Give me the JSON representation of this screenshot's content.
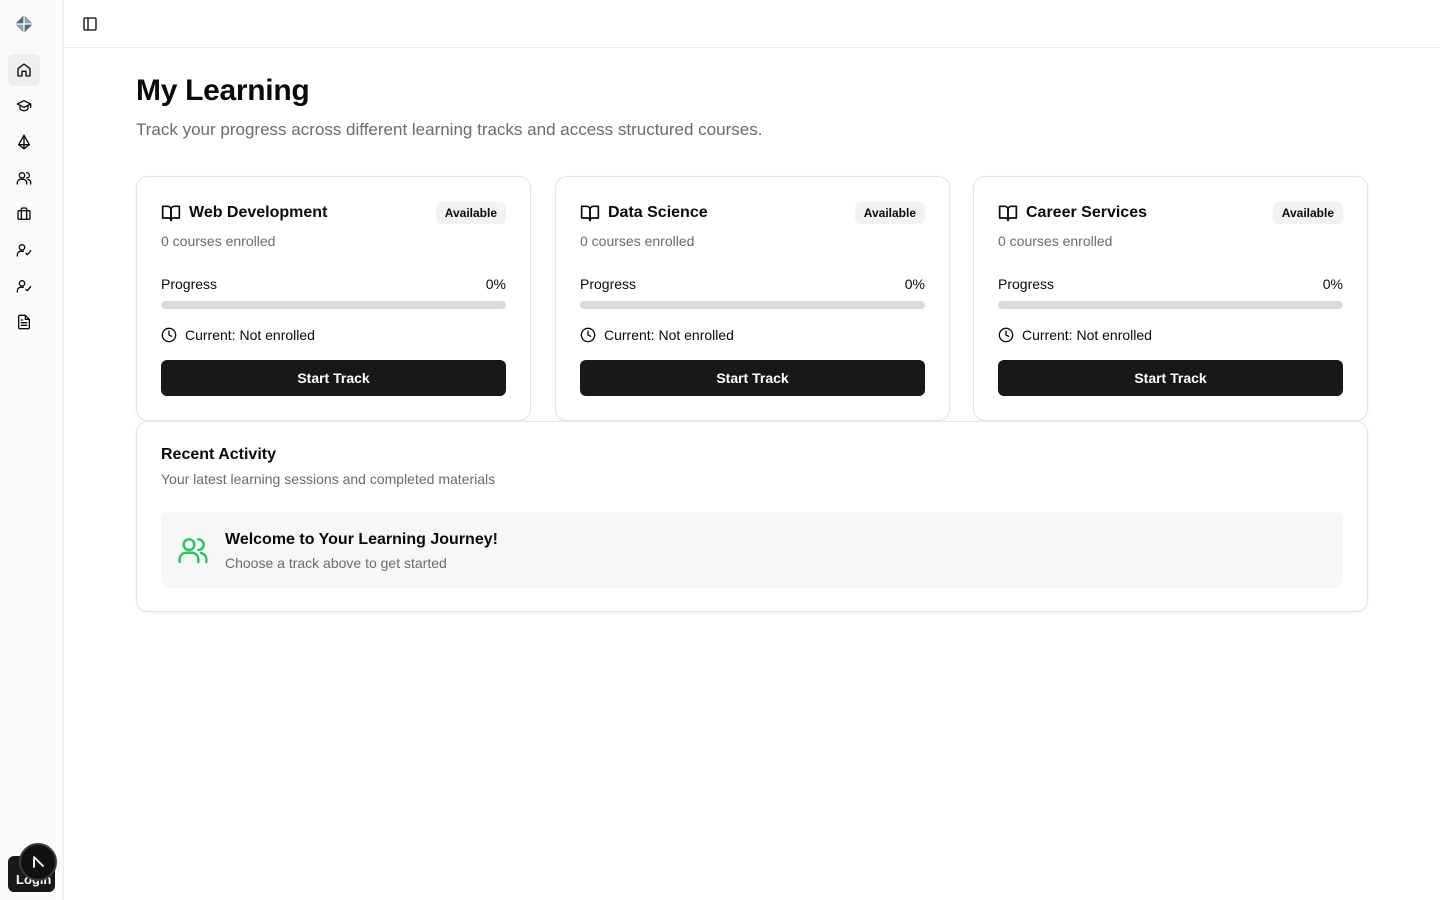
{
  "sidebar": {
    "logo_icon": "diamond-logo",
    "items": [
      {
        "icon": "home-icon",
        "active": true
      },
      {
        "icon": "graduation-cap-icon",
        "active": false
      },
      {
        "icon": "tracks-icon",
        "active": false
      },
      {
        "icon": "users-icon",
        "active": false
      },
      {
        "icon": "briefcase-icon",
        "active": false
      },
      {
        "icon": "user-check-icon",
        "active": false
      },
      {
        "icon": "user-check-icon",
        "active": false
      },
      {
        "icon": "document-icon",
        "active": false
      }
    ],
    "bottom_button_label": "Login"
  },
  "topbar": {
    "toggle_icon": "sidebar-toggle-icon"
  },
  "header": {
    "title": "My Learning",
    "subtitle": "Track your progress across different learning tracks and access structured courses."
  },
  "tracks": [
    {
      "title": "Web Development",
      "badge": "Available",
      "enrolled": "0 courses enrolled",
      "progress_label": "Progress",
      "progress_value": "0%",
      "progress": 0,
      "current": "Current: Not enrolled",
      "button": "Start Track"
    },
    {
      "title": "Data Science",
      "badge": "Available",
      "enrolled": "0 courses enrolled",
      "progress_label": "Progress",
      "progress_value": "0%",
      "progress": 0,
      "current": "Current: Not enrolled",
      "button": "Start Track"
    },
    {
      "title": "Career Services",
      "badge": "Available",
      "enrolled": "0 courses enrolled",
      "progress_label": "Progress",
      "progress_value": "0%",
      "progress": 0,
      "current": "Current: Not enrolled",
      "button": "Start Track"
    }
  ],
  "activity": {
    "title": "Recent Activity",
    "subtitle": "Your latest learning sessions and completed materials",
    "welcome_title": "Welcome to Your Learning Journey!",
    "welcome_subtitle": "Choose a track above to get started",
    "welcome_icon": "users-icon"
  },
  "colors": {
    "primary": "#18181b",
    "accent_green": "#22c55e",
    "muted_text": "#6b6b6b"
  }
}
